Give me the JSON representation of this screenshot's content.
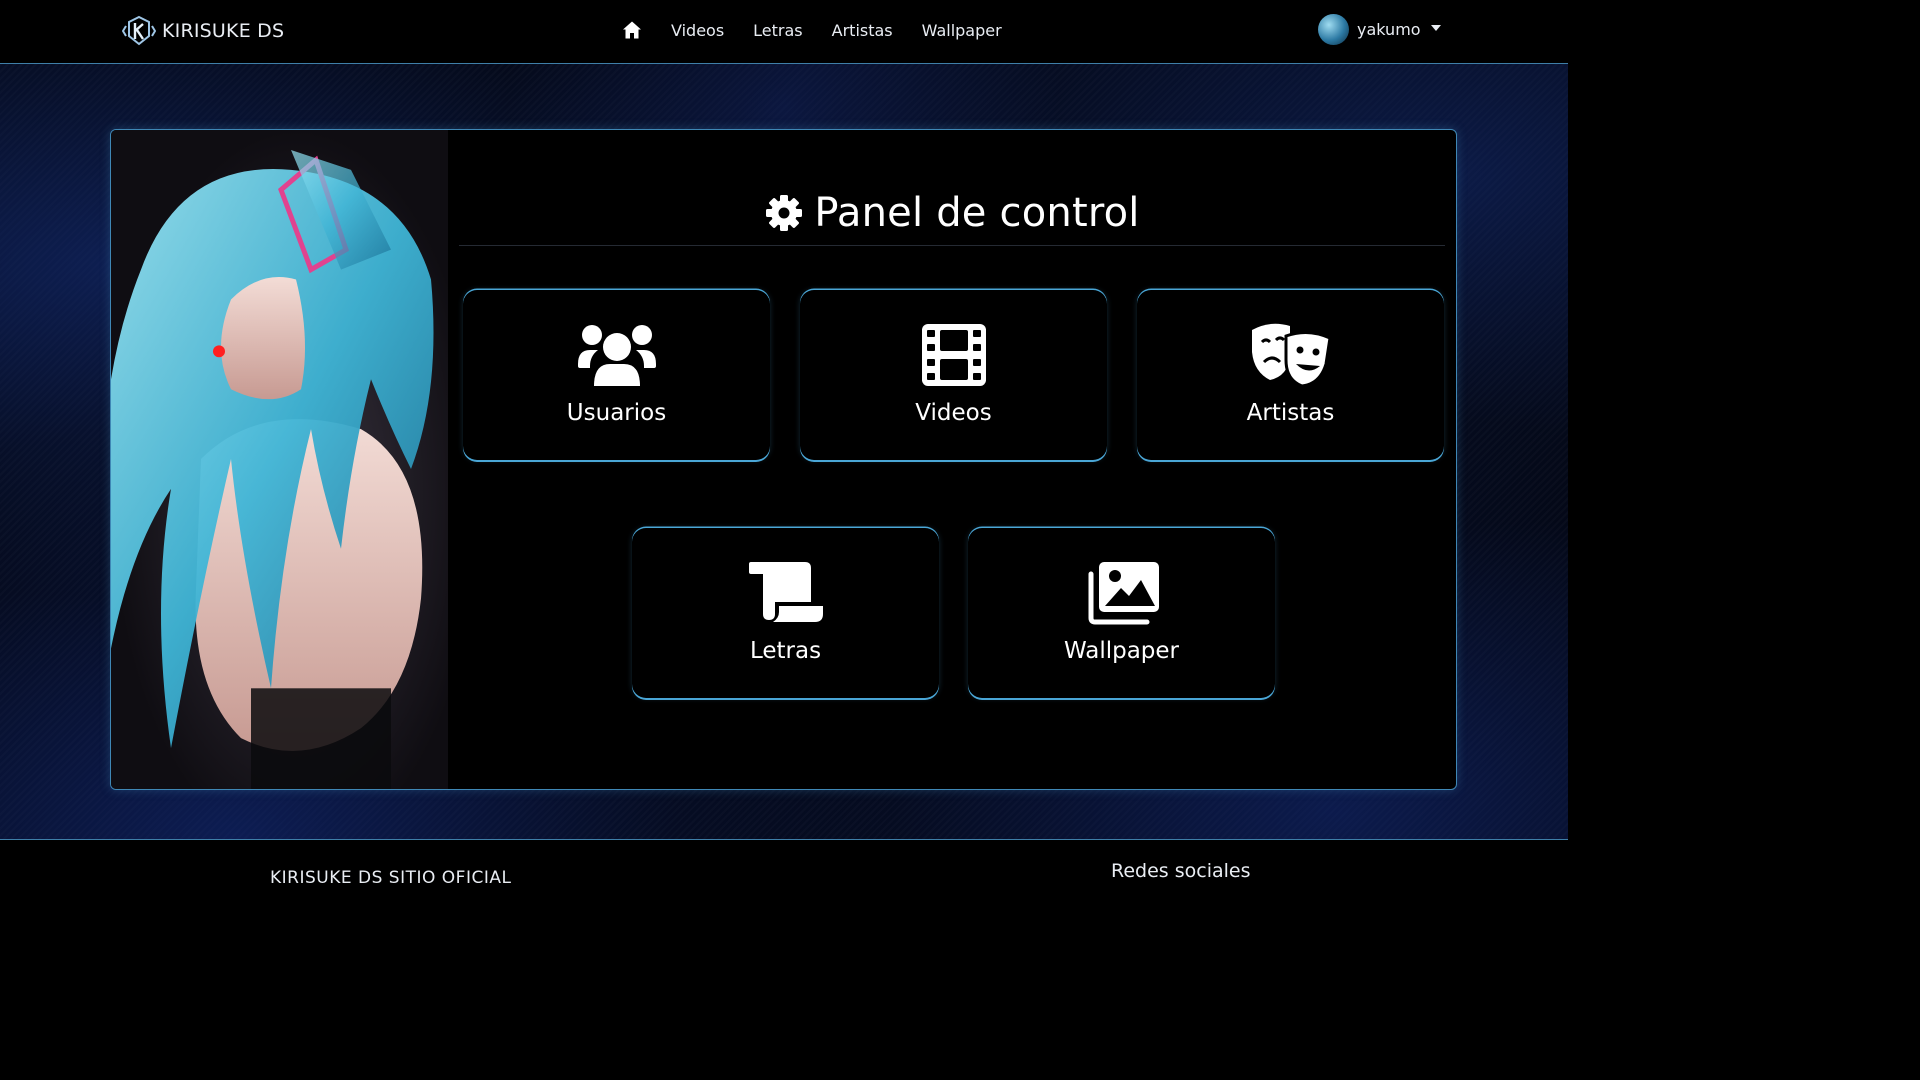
{
  "navbar": {
    "brand": "KIRISUKE DS",
    "links": [
      "Videos",
      "Letras",
      "Artistas",
      "Wallpaper"
    ],
    "user": "yakumo"
  },
  "panel": {
    "title": "Panel de control",
    "cards": [
      {
        "label": "Usuarios",
        "icon": "users-icon"
      },
      {
        "label": "Videos",
        "icon": "film-icon"
      },
      {
        "label": "Artistas",
        "icon": "theater-masks-icon"
      },
      {
        "label": "Letras",
        "icon": "scroll-icon"
      },
      {
        "label": "Wallpaper",
        "icon": "images-icon"
      }
    ]
  },
  "footer": {
    "site_title": "KIRISUKE DS SITIO OFICIAL",
    "social_heading": "Redes sociales"
  },
  "colors": {
    "accent": "#4aa6d6",
    "background": "#000000"
  }
}
